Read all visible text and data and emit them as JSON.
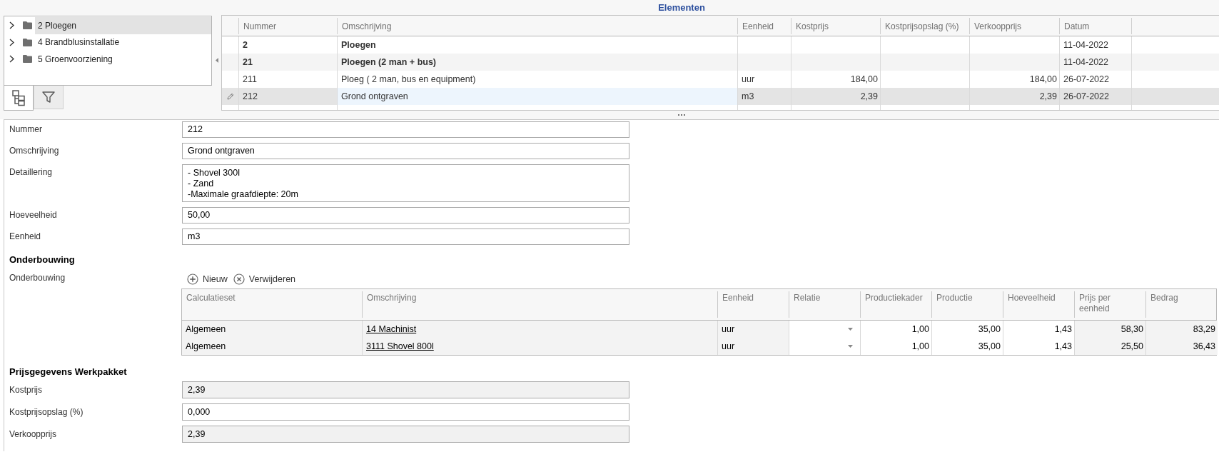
{
  "title": "Elementen",
  "tree": {
    "items": [
      {
        "label": "2 Ploegen",
        "expanded": false,
        "selected": true
      },
      {
        "label": "4 Brandblusinstallatie",
        "expanded": false,
        "selected": false
      },
      {
        "label": "5 Groenvoorziening",
        "expanded": false,
        "selected": false
      }
    ]
  },
  "panel_tabs": [
    {
      "kind": "tree",
      "selected": true
    },
    {
      "kind": "filter",
      "selected": false
    }
  ],
  "elements_table": {
    "columns": [
      {
        "label": "Nummer",
        "kind": "text",
        "focused": false
      },
      {
        "label": "Omschrijving",
        "kind": "text",
        "focused": true
      },
      {
        "label": "Eenheid",
        "kind": "text",
        "focused": false
      },
      {
        "label": "Kostprijs",
        "kind": "number",
        "focused": false
      },
      {
        "label": "Kostprijsopslag (%)",
        "kind": "number",
        "focused": false
      },
      {
        "label": "Verkoopprijs",
        "kind": "number",
        "focused": false
      },
      {
        "label": "Datum",
        "kind": "date",
        "focused": false
      }
    ],
    "rows": [
      {
        "kind": "group",
        "selected": false,
        "cells": [
          "2",
          "Ploegen",
          null,
          null,
          null,
          null,
          "11-04-2022"
        ]
      },
      {
        "kind": "group",
        "selected": false,
        "cells": [
          "21",
          "Ploegen (2 man + bus)",
          null,
          null,
          null,
          null,
          "11-04-2022"
        ]
      },
      {
        "kind": "item",
        "selected": false,
        "cells": [
          "211",
          "Ploeg ( 2 man, bus en equipment)",
          "uur",
          "184,00",
          null,
          "184,00",
          "26-07-2022"
        ]
      },
      {
        "kind": "item",
        "selected": true,
        "cells": [
          "212",
          "Grond ontgraven",
          "m3",
          "2,39",
          null,
          "2,39",
          "26-07-2022"
        ]
      }
    ]
  },
  "form": {
    "fields": [
      {
        "label": "Nummer",
        "kind": "text",
        "readonly": false,
        "value": "212"
      },
      {
        "label": "Omschrijving",
        "kind": "text",
        "readonly": false,
        "value": "Grond ontgraven"
      },
      {
        "label": "Detaillering",
        "kind": "multiline",
        "readonly": false,
        "value": "- Shovel 300l\n- Zand\n-Maximale graafdiepte: 20m"
      },
      {
        "label": "Hoeveelheid",
        "kind": "text",
        "readonly": false,
        "value": "50,00"
      },
      {
        "label": "Eenheid",
        "kind": "text",
        "readonly": false,
        "value": "m3"
      }
    ]
  },
  "breakdown": {
    "heading": "Onderbouwing",
    "label": "Onderbouwing",
    "actions": [
      {
        "kind": "add",
        "label": "Nieuw"
      },
      {
        "kind": "remove",
        "label": "Verwijderen"
      }
    ],
    "columns": [
      {
        "label": "Calculatieset",
        "kind": "readonly"
      },
      {
        "label": "Omschrijving",
        "kind": "link"
      },
      {
        "label": "Eenheid",
        "kind": "readonly"
      },
      {
        "label": "Relatie",
        "kind": "dropdown"
      },
      {
        "label": "Productiekader",
        "kind": "number"
      },
      {
        "label": "Productie",
        "kind": "number"
      },
      {
        "label": "Hoeveelheid",
        "kind": "number"
      },
      {
        "label": "Prijs per eenheid",
        "kind": "readonly_number"
      },
      {
        "label": "Bedrag",
        "kind": "readonly_number"
      }
    ],
    "rows": [
      [
        "Algemeen",
        "14 Machinist",
        "uur",
        null,
        "1,00",
        "35,00",
        "1,43",
        "58,30",
        "83,29"
      ],
      [
        "Algemeen",
        "3111 Shovel 800l",
        "uur",
        null,
        "1,00",
        "35,00",
        "1,43",
        "25,50",
        "36,43"
      ]
    ]
  },
  "pricing": {
    "heading": "Prijsgegevens Werkpakket",
    "fields": [
      {
        "label": "Kostprijs",
        "readonly": true,
        "value": "2,39"
      },
      {
        "label": "Kostprijsopslag (%)",
        "readonly": false,
        "value": "0,000"
      },
      {
        "label": "Verkoopprijs",
        "readonly": true,
        "value": "2,39"
      }
    ]
  }
}
